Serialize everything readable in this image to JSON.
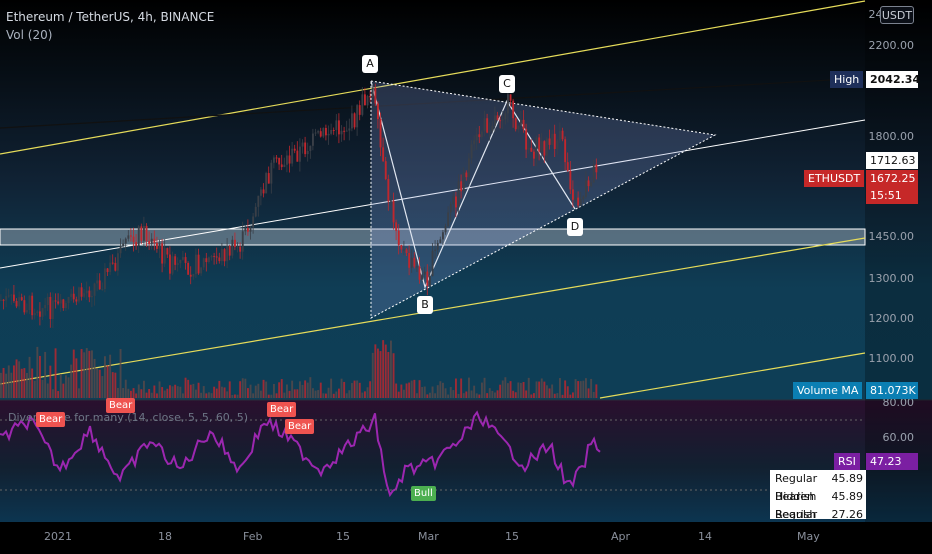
{
  "header": {
    "symbol": "Ethereum / TetherUS, 4h, BINANCE",
    "volume_label": "Vol (20)",
    "currency_button": "USDT"
  },
  "indicator": {
    "label": "Divergence for many (14, close, 5, 5, 60, 5)"
  },
  "price_axis": {
    "ticks": [
      "2400.00",
      "2200.00",
      "1800.00",
      "1450.00",
      "1300.00",
      "1200.00",
      "1100.00"
    ]
  },
  "rsi_axis": {
    "ticks": [
      "80.00",
      "60.00"
    ]
  },
  "time_axis": {
    "labels": [
      "2021",
      "18",
      "Feb",
      "15",
      "Mar",
      "15",
      "Apr",
      "14",
      "May"
    ]
  },
  "badges": {
    "high_label": "High",
    "high_value": "2042.34",
    "level_value": "1712.63",
    "ticker": "ETHUSDT",
    "last_price": "1672.25",
    "countdown": "15:51",
    "volume_ma_label": "Volume MA",
    "volume_ma_value": "81.073K",
    "rsi_label": "RSI",
    "rsi_value": "47.23"
  },
  "pattern_points": {
    "a": "A",
    "b": "B",
    "c": "C",
    "d": "D"
  },
  "signals": {
    "bear": "Bear",
    "bull": "Bull"
  },
  "divergence_table": [
    {
      "label": "Regular Bearish",
      "value": "45.89"
    },
    {
      "label": "Hidden Bearish",
      "value": "45.89"
    },
    {
      "label": "Regular Bullish",
      "value": "27.26"
    }
  ],
  "colors": {
    "background": "#000000",
    "up_candle": "#3a3f47",
    "down_candle": "#c0272d",
    "channel_line": "#e6dc5a",
    "trend_line": "#ffffff",
    "rsi_line": "#9c27b0",
    "bear_badge": "#ef5350",
    "bull_badge": "#4caf50",
    "last_price_badge": "#c62828",
    "high_badge": "#1e2f5a",
    "volume_ma_badge": "#0b7fb3",
    "rsi_badge": "#7b1fa2"
  }
}
